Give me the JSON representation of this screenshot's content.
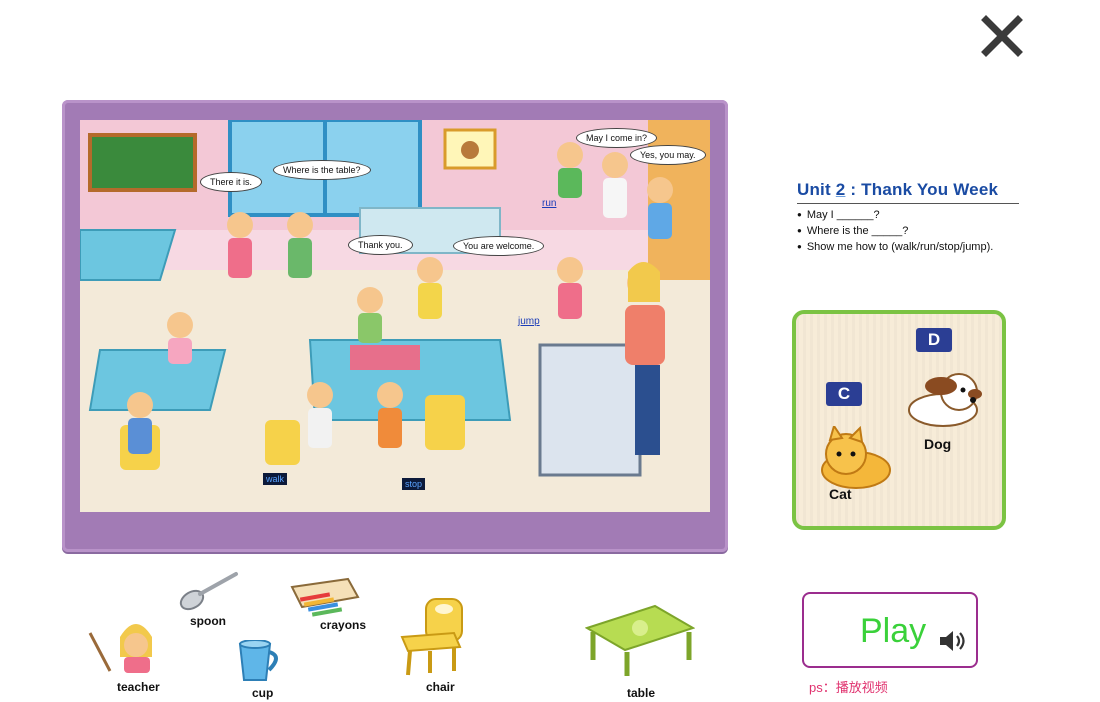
{
  "scene_bubbles": {
    "there_it_is": "There it is.",
    "where_table": "Where is the table?",
    "may_come_in": "May I come in?",
    "yes_you_may": "Yes, you may.",
    "thank_you": "Thank you.",
    "welcome": "You are welcome."
  },
  "scene_tags": {
    "run": "run",
    "jump": "jump",
    "walk": "walk",
    "stop": "stop"
  },
  "info_panel": {
    "unit_prefix": "Unit",
    "unit_number": "2",
    "unit_title": ": Thank You Week",
    "lines": [
      "May I ______?",
      "Where is the _____?",
      "Show me how to (walk/run/stop/jump)."
    ]
  },
  "card": {
    "letter_d": "D",
    "letter_c": "C",
    "dog_label": "Dog",
    "cat_label": "Cat",
    "border_color": "#7bc343"
  },
  "vocab": {
    "teacher": "teacher",
    "spoon": "spoon",
    "cup": "cup",
    "crayons": "crayons",
    "chair": "chair",
    "table": "table"
  },
  "play": {
    "label": "Play",
    "icon": "speaker-icon",
    "color": "#3ad13a",
    "border": "#9b2d8e"
  },
  "ps_note": "ps：播放视频",
  "close_icon": "close-icon"
}
